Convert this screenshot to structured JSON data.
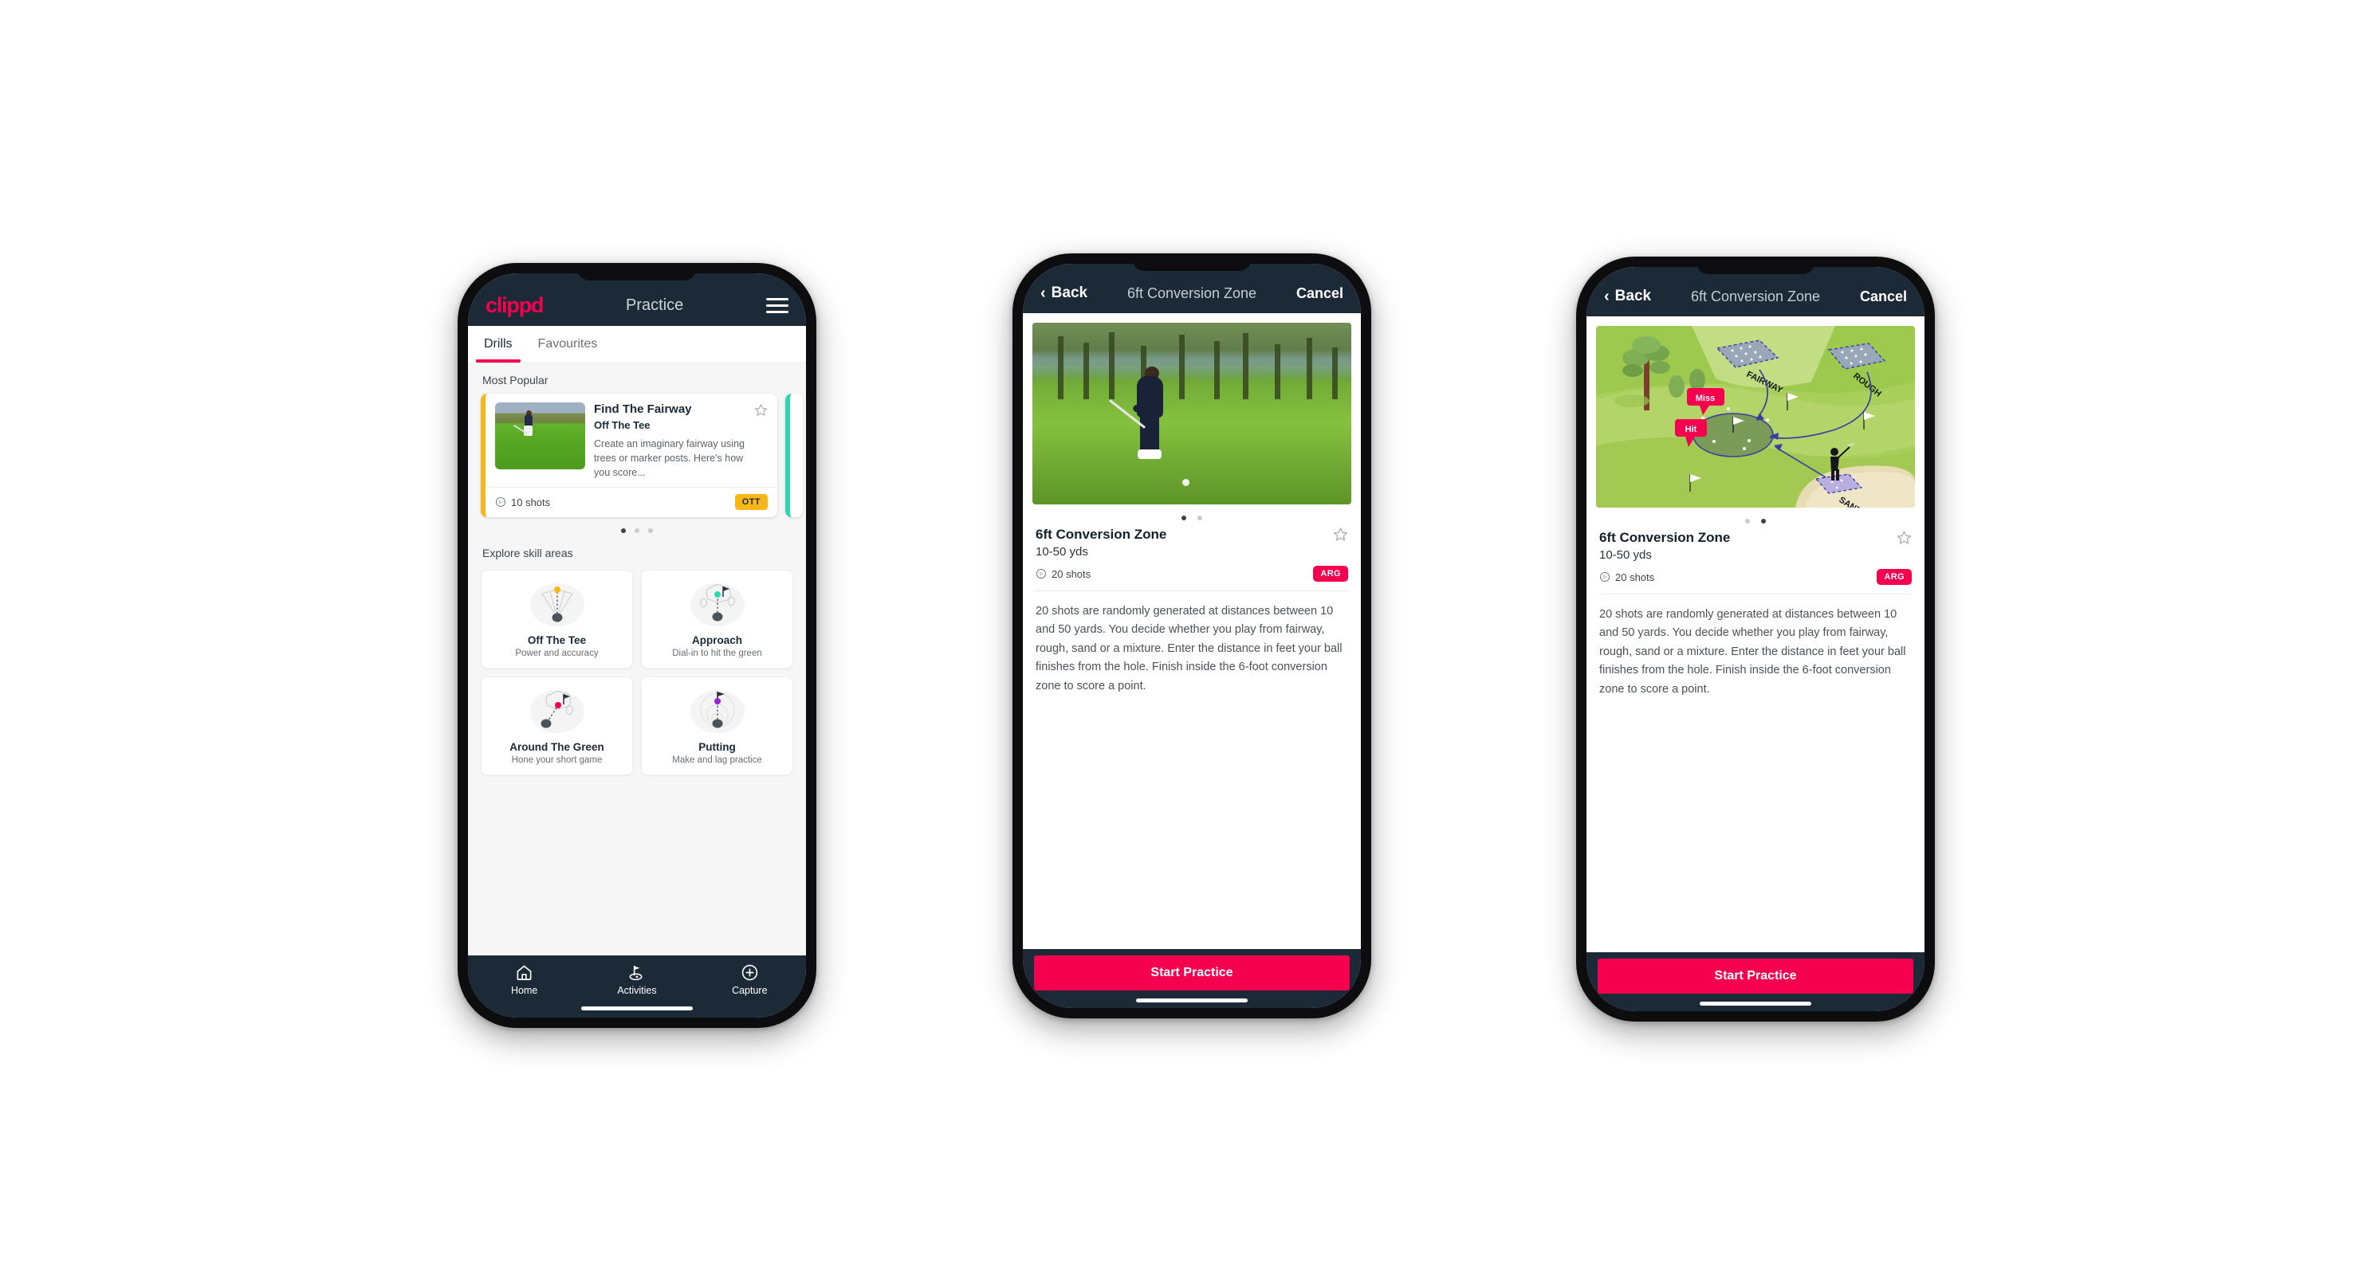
{
  "app": {
    "brand": "clippd",
    "accent_pink": "#f5004f",
    "navy": "#1b2a36",
    "amber": "#f7b718",
    "teal": "#2fd7ae"
  },
  "phone1": {
    "appbar": {
      "logo": "clippd",
      "title": "Practice",
      "menu_icon": "hamburger-icon"
    },
    "tabs": [
      {
        "label": "Drills",
        "active": true
      },
      {
        "label": "Favourites",
        "active": false
      }
    ],
    "sections": {
      "most_popular_label": "Most Popular",
      "explore_label": "Explore skill areas"
    },
    "drill_card": {
      "title": "Find The Fairway",
      "subtitle": "Off The Tee",
      "description": "Create an imaginary fairway using trees or marker posts. Here's how you score...",
      "shots": "10 shots",
      "badge": "OTT",
      "badge_color": "#f7b718",
      "accent_color": "#f7b718",
      "star_icon": "star-outline-icon",
      "shots_icon": "golf-ball-icon"
    },
    "carousel_dots": {
      "count": 3,
      "active_index": 0
    },
    "skills": [
      {
        "name": "Off The Tee",
        "desc": "Power and accuracy",
        "icon": "tee-dispersion-icon",
        "dot_color": "#f7b718"
      },
      {
        "name": "Approach",
        "desc": "Dial-in to hit the green",
        "icon": "green-approach-icon",
        "dot_color": "#2fd7ae"
      },
      {
        "name": "Around The Green",
        "desc": "Hone your short game",
        "icon": "chip-around-green-icon",
        "dot_color": "#f5004f"
      },
      {
        "name": "Putting",
        "desc": "Make and lag practice",
        "icon": "putting-rings-icon",
        "dot_color": "#a020d8"
      }
    ],
    "tabbar": [
      {
        "label": "Home",
        "icon": "home-icon",
        "active": false
      },
      {
        "label": "Activities",
        "icon": "golf-flag-icon",
        "active": true
      },
      {
        "label": "Capture",
        "icon": "plus-circle-icon",
        "active": false
      }
    ]
  },
  "phone2": {
    "navbar": {
      "back": "Back",
      "title": "6ft Conversion Zone",
      "cancel": "Cancel",
      "back_icon": "chevron-left-icon"
    },
    "hero": {
      "type": "photo",
      "alt": "golfer chipping on fairway"
    },
    "dots": {
      "count": 2,
      "active_index": 0
    },
    "detail": {
      "title": "6ft Conversion Zone",
      "yards": "10-50 yds",
      "shots": "20 shots",
      "badge": "ARG",
      "badge_color": "#f5004f",
      "star_icon": "star-outline-icon",
      "shots_icon": "golf-ball-icon",
      "description": "20 shots are randomly generated at distances between 10 and 50 yards. You decide whether you play from fairway, rough, sand or a mixture. Enter the distance in feet your ball finishes from the hole. Finish inside the 6-foot conversion zone to score a point."
    },
    "cta": "Start Practice"
  },
  "phone3": {
    "navbar": {
      "back": "Back",
      "title": "6ft Conversion Zone",
      "cancel": "Cancel",
      "back_icon": "chevron-left-icon"
    },
    "hero": {
      "type": "illustration",
      "labels": {
        "fairway": "FAIRWAY",
        "rough": "ROUGH",
        "sand": "SAND",
        "miss": "Miss",
        "hit": "Hit"
      }
    },
    "dots": {
      "count": 2,
      "active_index": 1
    },
    "detail": {
      "title": "6ft Conversion Zone",
      "yards": "10-50 yds",
      "shots": "20 shots",
      "badge": "ARG",
      "badge_color": "#f5004f",
      "star_icon": "star-outline-icon",
      "shots_icon": "golf-ball-icon",
      "description": "20 shots are randomly generated at distances between 10 and 50 yards. You decide whether you play from fairway, rough, sand or a mixture. Enter the distance in feet your ball finishes from the hole. Finish inside the 6-foot conversion zone to score a point."
    },
    "cta": "Start Practice"
  }
}
